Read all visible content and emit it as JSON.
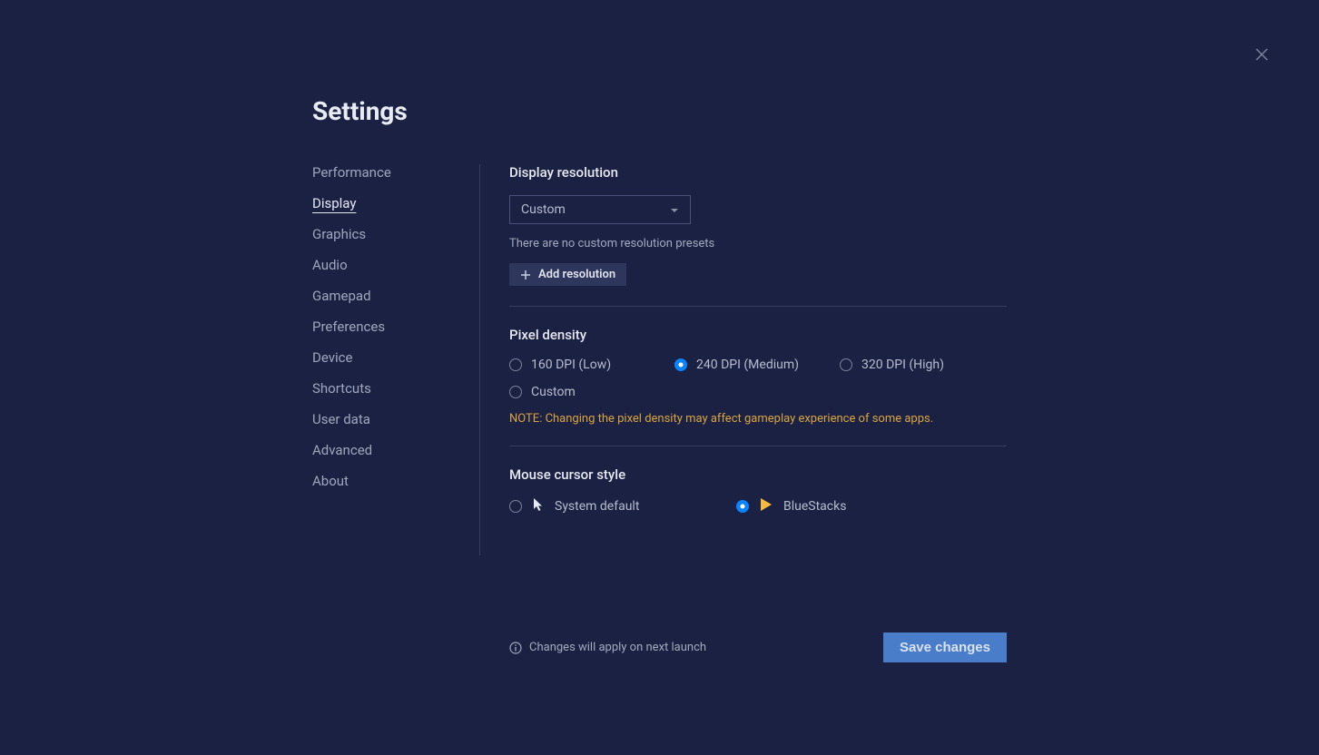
{
  "title": "Settings",
  "sidebar": {
    "items": [
      {
        "label": "Performance",
        "active": false
      },
      {
        "label": "Display",
        "active": true
      },
      {
        "label": "Graphics",
        "active": false
      },
      {
        "label": "Audio",
        "active": false
      },
      {
        "label": "Gamepad",
        "active": false
      },
      {
        "label": "Preferences",
        "active": false
      },
      {
        "label": "Device",
        "active": false
      },
      {
        "label": "Shortcuts",
        "active": false
      },
      {
        "label": "User data",
        "active": false
      },
      {
        "label": "Advanced",
        "active": false
      },
      {
        "label": "About",
        "active": false
      }
    ]
  },
  "resolution": {
    "title": "Display resolution",
    "selected": "Custom",
    "help": "There are no custom resolution presets",
    "add_label": "Add resolution"
  },
  "density": {
    "title": "Pixel density",
    "options": [
      {
        "label": "160 DPI (Low)",
        "selected": false
      },
      {
        "label": "240 DPI (Medium)",
        "selected": true
      },
      {
        "label": "320 DPI (High)",
        "selected": false
      },
      {
        "label": "Custom",
        "selected": false
      }
    ],
    "note": "NOTE: Changing the pixel density may affect gameplay experience of some apps."
  },
  "cursor": {
    "title": "Mouse cursor style",
    "options": [
      {
        "label": "System default",
        "selected": false
      },
      {
        "label": "BlueStacks",
        "selected": true
      }
    ]
  },
  "footer": {
    "note": "Changes will apply on next launch",
    "save": "Save changes"
  }
}
